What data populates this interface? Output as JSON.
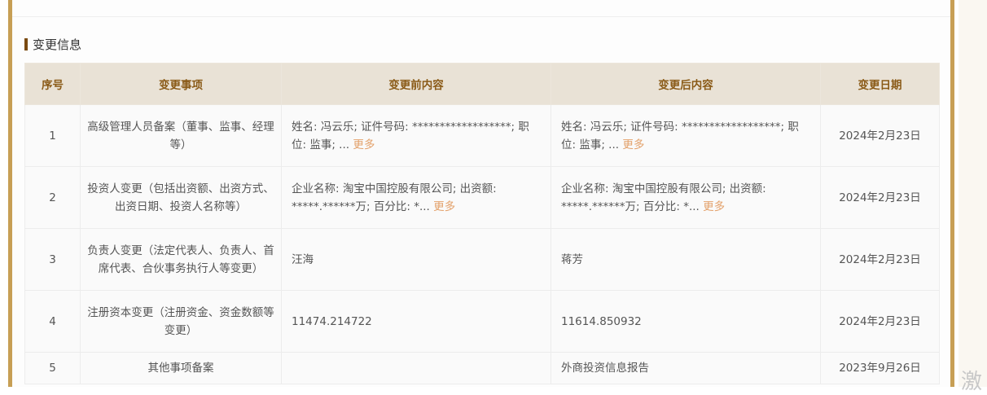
{
  "section": {
    "title": "变更信息"
  },
  "table": {
    "headers": [
      "序号",
      "变更事项",
      "变更前内容",
      "变更后内容",
      "变更日期"
    ],
    "rows": [
      {
        "idx": "1",
        "item": "高级管理人员备案（董事、监事、经理等）",
        "before": "姓名: 冯云乐; 证件号码: ******************; 职位: 监事; ...",
        "before_more": "更多",
        "after": "姓名: 冯云乐; 证件号码: ******************; 职位: 监事; ...",
        "after_more": "更多",
        "date": "2024年2月23日"
      },
      {
        "idx": "2",
        "item": "投资人变更（包括出资额、出资方式、出资日期、投资人名称等）",
        "before": "企业名称: 淘宝中国控股有限公司; 出资额: *****.******万; 百分比: *...",
        "before_more": "更多",
        "after": "企业名称: 淘宝中国控股有限公司; 出资额: *****.******万; 百分比: *...",
        "after_more": "更多",
        "date": "2024年2月23日"
      },
      {
        "idx": "3",
        "item": "负责人变更（法定代表人、负责人、首席代表、合伙事务执行人等变更）",
        "before": "汪海",
        "before_more": "",
        "after": "蒋芳",
        "after_more": "",
        "date": "2024年2月23日"
      },
      {
        "idx": "4",
        "item": "注册资本变更（注册资金、资金数额等变更）",
        "before": "11474.214722",
        "before_more": "",
        "after": "11614.850932",
        "after_more": "",
        "date": "2024年2月23日"
      },
      {
        "idx": "5",
        "item": "其他事项备案",
        "before": "",
        "before_more": "",
        "after": "外商投资信息报告",
        "after_more": "",
        "date": "2023年9月26日"
      }
    ]
  },
  "side": {
    "glyph": "激"
  }
}
